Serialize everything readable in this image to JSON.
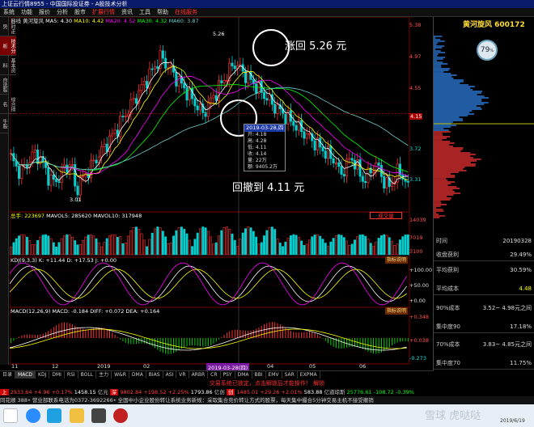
{
  "window": {
    "title": "上证云行情8955 - 中国国际投证券 - A股技术分析"
  },
  "menu": [
    "系统",
    "功能",
    "报价",
    "分析",
    "股市",
    "扩展行情",
    "资讯",
    "工具",
    "帮助",
    "在线服务"
  ],
  "menu_active": "扩展行情",
  "sidebar_tabs": [
    "分时走势",
    "技术分析",
    "基本资料",
    "自选股",
    "综合排名",
    "牛股"
  ],
  "chart_header": {
    "period": "日线",
    "name": "黄河旋风",
    "ma_text": "MA5: 4.30",
    "ma10": "MA10: 4.42",
    "ma20": "MA20: 4.52",
    "ma30": "MA30: 4.32",
    "ma60": "MA60: 3.87"
  },
  "price_axis": [
    "5.38",
    "4.97",
    "4.55",
    "4.15",
    "3.72",
    "3.31",
    "2.89"
  ],
  "price_labels": {
    "high": "5.26",
    "low": "3.01"
  },
  "annotations": {
    "rebound": "涨回 5.26 元",
    "pullback": "回撤到 4.11 元"
  },
  "tooltip": {
    "date": "2019-03-28,四",
    "rows": [
      "开: 4.18",
      "高: 4.28",
      "低: 4.11",
      "收: 4.14",
      "量: 22万",
      "额: 9405.2万"
    ]
  },
  "volume": {
    "header": "总手: 223697",
    "mavol5": "MAVOL5: 285620",
    "mavol10": "MAVOL10: 317948",
    "button": "成交量",
    "axis": [
      "14039",
      "7019",
      "3100"
    ]
  },
  "kdj": {
    "header": "KDJ(9,3,3)  K: +11.44  D: +17.53  J: +0.00",
    "button": "指标说明",
    "axis": [
      "+100.00",
      "+50.00",
      "+0.00"
    ]
  },
  "macd": {
    "header": "MACD(12,26,9)  MACD: -0.184  DIFF: +0.072  DEA: +0.164",
    "button": "指标说明",
    "axis": [
      "+0.348",
      "+0.038",
      "-0.273"
    ]
  },
  "x_axis": [
    "11",
    "12",
    "2019",
    "02",
    "03",
    "04",
    "05",
    "06"
  ],
  "x_axis_highlight": "2019-03-28(四)",
  "bottom_tabs": [
    "日录",
    "MACD",
    "KDJ",
    "DMI",
    "RSI",
    "BOLL",
    "主力",
    "W&R",
    "DMA",
    "BIAS",
    "ASI",
    "VR",
    "ARBR",
    "CR",
    "PSY",
    "DMA",
    "BBI",
    "EMV",
    "SAR",
    "EXPMA"
  ],
  "bottom_active": "MACD",
  "notice": "交易系统已锁定，点击解锁后才能操作！ 解锁",
  "ticker": {
    "a": "2933.64",
    "a_chg": "+4.96",
    "a_pct": "+0.17%",
    "b": "1458.15",
    "b_label": "亿元",
    "c": "9802.84",
    "c_chg": "+198.52",
    "c_pct": "+2.25%",
    "d": "1793.86",
    "d_label": "亿创",
    "e": "1485.01",
    "e_chg": "+29.26",
    "e_pct": "+2.01%",
    "f": "583.88",
    "f_label": "亿道琼斯",
    "g": "25776.61",
    "g_chg": "-108.72",
    "g_pct": "-0.39%"
  },
  "ticker2": "同花顺  388• 营业部联系电话为0372-3692266•   全国中小企业股份转让系统业务新规：采取集合竞价转让方式的股票，每天集中撮合5分钟交易主机不接受撤销",
  "right_panel": {
    "title": "黄河旋风 600172",
    "gauge": "79",
    "gauge_unit": "%",
    "rows": [
      {
        "k": "时间",
        "v": "20190328"
      },
      {
        "k": "收盘获利",
        "v": "29.49%"
      },
      {
        "k": "平均获利",
        "v": "30.59%"
      },
      {
        "k": "平均成本",
        "v": "4.48"
      },
      {
        "k": "90%成本",
        "v": "3.52~    4.98元之间"
      },
      {
        "k": "集中度90",
        "v": "17.18%"
      },
      {
        "k": "70%成本",
        "v": "3.83~   4.85元之间"
      },
      {
        "k": "集中度70",
        "v": "11.75%"
      }
    ]
  },
  "taskbar": {
    "time": "2019/6/19",
    "watermark": "雪球 虎哒哒"
  },
  "colors": {
    "up": "#ff3030",
    "down": "#00d0d0",
    "ma5": "#ffffff",
    "ma10": "#ffff00",
    "ma20": "#ff00ff",
    "ma30": "#00ff00",
    "ma60": "#6ccfcf"
  }
}
